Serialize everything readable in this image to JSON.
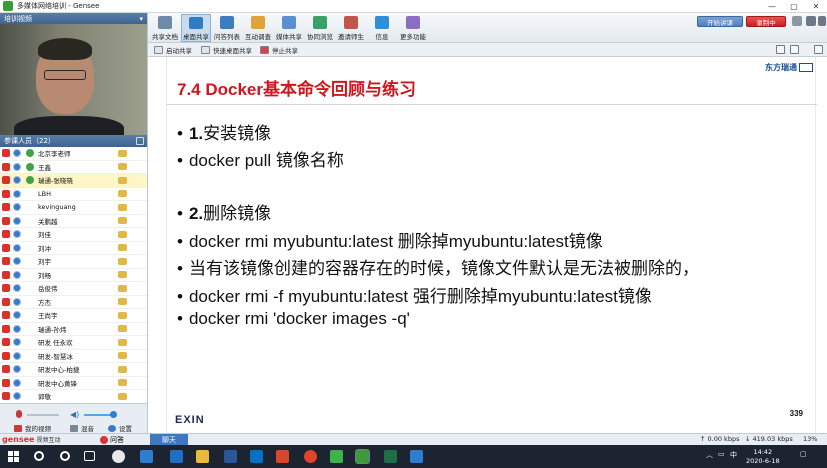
{
  "window": {
    "title": "多媒体网络培训 - Gensee",
    "controls": [
      "—",
      "▢",
      "✕"
    ]
  },
  "video_panel": {
    "title": "培训视频"
  },
  "participants": {
    "header": "参课人员（22）",
    "list": [
      {
        "name": "北京李老师",
        "role": "teacher"
      },
      {
        "name": "王鑫",
        "role": "presenter"
      },
      {
        "name": "瑞通-张晓晓",
        "role": "presenter",
        "selected": true
      },
      {
        "name": "LBH",
        "role": "student"
      },
      {
        "name": "kevinguang",
        "role": "student"
      },
      {
        "name": "关鹏越",
        "role": "student"
      },
      {
        "name": "刘佳",
        "role": "student"
      },
      {
        "name": "刘冲",
        "role": "student"
      },
      {
        "name": "刘宇",
        "role": "student"
      },
      {
        "name": "刘畅",
        "role": "student"
      },
      {
        "name": "岳俊伟",
        "role": "student"
      },
      {
        "name": "方杰",
        "role": "student"
      },
      {
        "name": "王尚宇",
        "role": "student"
      },
      {
        "name": "瑞通-孙炜",
        "role": "student"
      },
      {
        "name": "研发 任永欢",
        "role": "student"
      },
      {
        "name": "研发-智慧冰",
        "role": "student"
      },
      {
        "name": "研发中心-柏捷",
        "role": "student"
      },
      {
        "name": "研发中心黄锋",
        "role": "student"
      },
      {
        "name": "郭敬",
        "role": "student"
      }
    ]
  },
  "left_controls": {
    "my_video": "我的视频",
    "mix": "混音",
    "settings": "设置"
  },
  "toolbar": {
    "buttons": [
      {
        "label": "共享文档",
        "color": "#6f8aa8"
      },
      {
        "label": "桌面共享",
        "color": "#2f7cc2",
        "active": true
      },
      {
        "label": "问答列表",
        "color": "#3b7dbf"
      },
      {
        "label": "互动调查",
        "color": "#e0a23a"
      },
      {
        "label": "媒体共享",
        "color": "#5a8fd0"
      },
      {
        "label": "协同浏览",
        "color": "#3aa06a"
      },
      {
        "label": "邀请师生",
        "color": "#c0574a"
      },
      {
        "label": "信息",
        "color": "#2f8fd8"
      },
      {
        "label": "更多功能",
        "color": "#8a6fc2"
      }
    ],
    "start_live": "开始讲课",
    "record": "录制中"
  },
  "sub_toolbar": {
    "start_share": "启动共享",
    "quick_share": "快速桌面共享",
    "stop_share": "停止共享"
  },
  "slide": {
    "title": "7.4 Docker基本命令回顾与练习",
    "logo": "东方瑞通",
    "items": [
      {
        "prefix": "1.",
        "text": "安装镜像"
      },
      {
        "text": "docker pull 镜像名称"
      },
      {
        "prefix": "2.",
        "text": "删除镜像"
      },
      {
        "text": "docker rmi myubuntu:latest  删除掉myubuntu:latest镜像"
      },
      {
        "text": "当有该镜像创建的容器存在的时候，镜像文件默认是无法被删除的，"
      },
      {
        "text": "docker rmi -f myubuntu:latest  强行删除掉myubuntu:latest镜像"
      },
      {
        "text": "docker rmi 'docker images -q'"
      }
    ],
    "footer_logo": "EXIN",
    "page": "339"
  },
  "status": {
    "brand": "gensee",
    "brand_sub": "视频互动",
    "qa": "问答",
    "chat": "聊天",
    "up": "0.00 kbps",
    "down": "419.03 kbps",
    "pct": "13%"
  },
  "taskbar": {
    "ime": "中",
    "time": "14:42",
    "date": "2020-6-18"
  }
}
